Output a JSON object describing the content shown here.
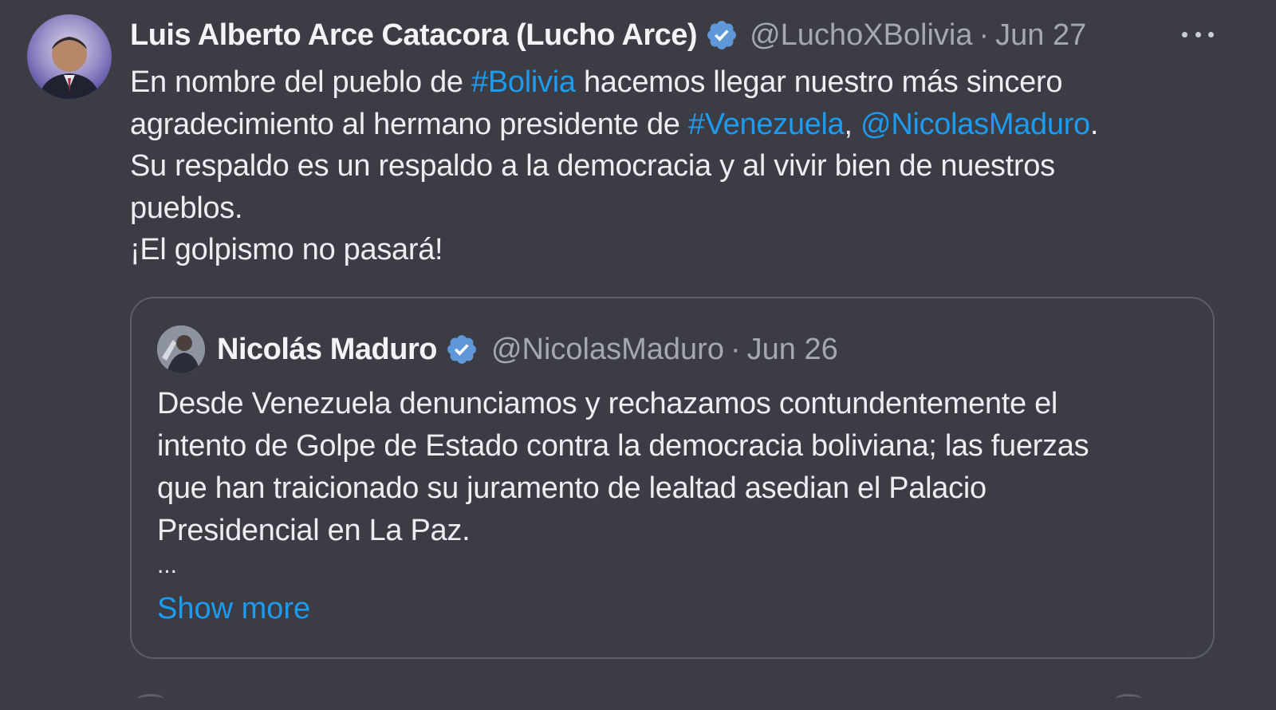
{
  "tweet": {
    "author": {
      "display_name": "Luis Alberto Arce Catacora (Lucho Arce)",
      "handle": "@LuchoXBolivia",
      "separator": "·",
      "date": "Jun 27",
      "verified_icon": "verified-badge-icon"
    },
    "more_icon": "more-options-icon",
    "body": {
      "line1": {
        "pre": "En nombre del pueblo de ",
        "hashtag": "#Bolivia",
        "post": " hacemos llegar nuestro más sincero"
      },
      "line2": {
        "pre": "agradecimiento al hermano presidente de ",
        "hashtag": "#Venezuela",
        "comma": ", ",
        "mention": "@NicolasMaduro",
        "post": "."
      },
      "line3": "Su respaldo es un respaldo a la democracia y al vivir bien de nuestros",
      "line4": "pueblos.",
      "line5": "¡El golpismo no pasará!"
    },
    "quoted": {
      "display_name": "Nicolás Maduro",
      "handle": "@NicolasMaduro",
      "separator": "·",
      "date": "Jun 26",
      "verified_icon": "verified-badge-icon",
      "body_lines": [
        "Desde Venezuela denunciamos y rechazamos contundentemente el",
        "intento de Golpe de Estado contra la democracia boliviana; las fuerzas",
        "que han traicionado su juramento de lealtad asedian el Palacio",
        "Presidencial en La Paz."
      ],
      "ellipsis": "...",
      "show_more": "Show more"
    }
  },
  "colors": {
    "background": "#3b3c44",
    "link": "#1d9bf0",
    "verified": "#5f97d8",
    "text": "#eceef2",
    "muted": "#a5a8b0"
  }
}
